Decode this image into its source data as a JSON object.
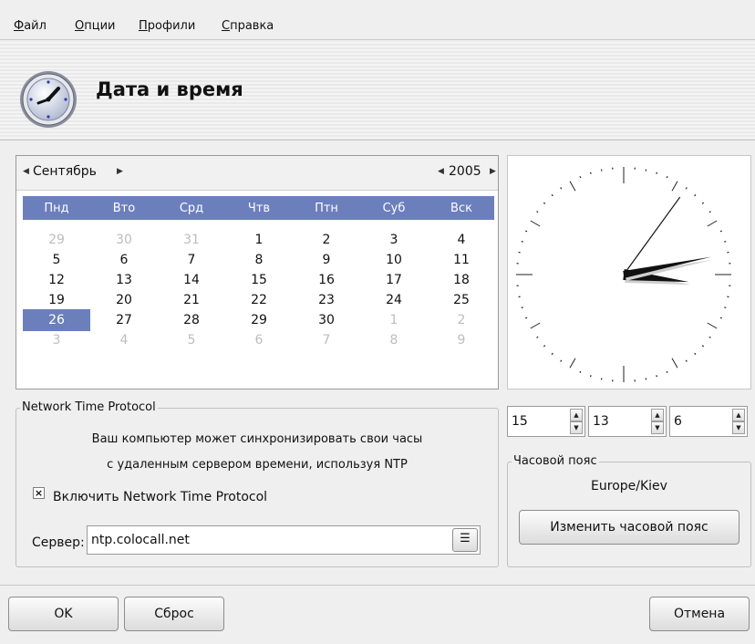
{
  "menu": {
    "items": [
      {
        "accel": "Ф",
        "rest": "айл"
      },
      {
        "accel": "О",
        "rest": "пции"
      },
      {
        "accel": "П",
        "rest": "рофили"
      },
      {
        "accel": "С",
        "rest": "правка"
      }
    ]
  },
  "header": {
    "title": "Дата и время",
    "icon": "clock-icon"
  },
  "calendar": {
    "month": "Сентябрь",
    "year": "2005",
    "weekdays": [
      "Пнд",
      "Вто",
      "Срд",
      "Чтв",
      "Птн",
      "Суб",
      "Вск"
    ],
    "weeks": [
      [
        "29",
        "30",
        "31",
        "1",
        "2",
        "3",
        "4"
      ],
      [
        "5",
        "6",
        "7",
        "8",
        "9",
        "10",
        "11"
      ],
      [
        "12",
        "13",
        "14",
        "15",
        "16",
        "17",
        "18"
      ],
      [
        "19",
        "20",
        "21",
        "22",
        "23",
        "24",
        "25"
      ],
      [
        "26",
        "27",
        "28",
        "29",
        "30",
        "1",
        "2"
      ],
      [
        "3",
        "4",
        "5",
        "6",
        "7",
        "8",
        "9"
      ]
    ],
    "selected_day": "26",
    "selection_color": "#6c7fbd"
  },
  "clock": {
    "hour": 15,
    "minute": 13,
    "second": 6
  },
  "time": {
    "hour": "15",
    "minute": "13",
    "second": "6"
  },
  "ntp": {
    "group_title": "Network Time Protocol",
    "description_line1": "Ваш компьютер может синхронизировать свои часы",
    "description_line2": "с удаленным сервером времени, используя NTP",
    "enable_label": "Включить Network Time Protocol",
    "enabled": true,
    "check_mark": "×",
    "server_label": "Сервер:",
    "server_value": "ntp.colocall.net"
  },
  "timezone": {
    "group_title": "Часовой пояс",
    "value": "Europe/Kiev",
    "change_label": "Изменить часовой пояс"
  },
  "buttons": {
    "ok": "OK",
    "reset": "Сброс",
    "cancel": "Отмена"
  }
}
